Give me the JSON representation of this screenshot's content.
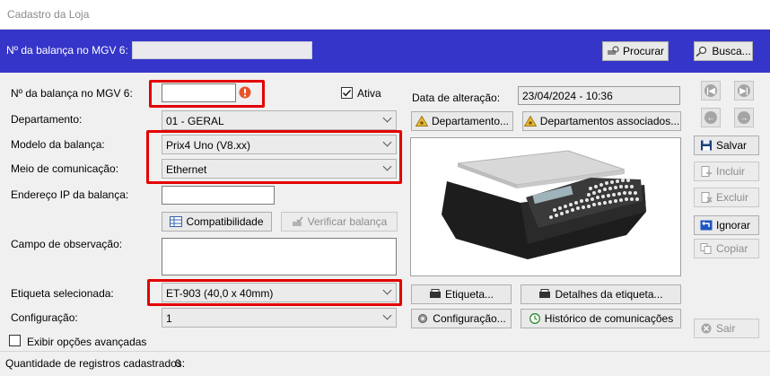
{
  "window": {
    "title": "Cadastro da Loja"
  },
  "search_bar": {
    "label": "Nº da balança no MGV 6:",
    "value": "",
    "procurar_label": "Procurar",
    "busca_label": "Busca..."
  },
  "form": {
    "scale_number": {
      "label": "Nº da balança no MGV 6:",
      "value": "",
      "error_icon": "exclamation-icon"
    },
    "active": {
      "label": "Ativa",
      "checked": true
    },
    "department": {
      "label": "Departamento:",
      "value": "01 - GERAL"
    },
    "scale_model": {
      "label": "Modelo da balança:",
      "value": "Prix4 Uno (V8.xx)"
    },
    "comm_medium": {
      "label": "Meio de comunicação:",
      "value": "Ethernet"
    },
    "ip_address": {
      "label": "Endereço IP da balança:",
      "value": ""
    },
    "compat_label": "Compatibilidade",
    "verify_label": "Verificar balança",
    "observation": {
      "label": "Campo de observação:",
      "value": ""
    },
    "label_selected": {
      "label": "Etiqueta selecionada:",
      "value": "ET-903 (40,0 x 40mm)"
    },
    "configuration": {
      "label": "Configuração:",
      "value": "1"
    },
    "advanced": {
      "label": "Exibir opções avançadas",
      "checked": false
    }
  },
  "details": {
    "date_label": "Data de alteração:",
    "date_value": "23/04/2024 - 10:36",
    "departamento_btn": "Departamento...",
    "departamentos_assoc_btn": "Departamentos associados...",
    "etiqueta_btn": "Etiqueta...",
    "detalhes_etiqueta_btn": "Detalhes da etiqueta...",
    "configuracao_btn": "Configuração...",
    "historico_btn": "Histórico de comunicações"
  },
  "side_actions": {
    "salvar": "Salvar",
    "incluir": "Incluir",
    "excluir": "Excluir",
    "ignorar": "Ignorar",
    "copiar": "Copiar",
    "sair": "Sair"
  },
  "status_bar": {
    "label": "Quantidade de registros cadastrados:",
    "count": "0"
  },
  "colors": {
    "header_blue": "#3535c9",
    "highlight_red": "#e30000",
    "error_orange": "#e8542a"
  }
}
